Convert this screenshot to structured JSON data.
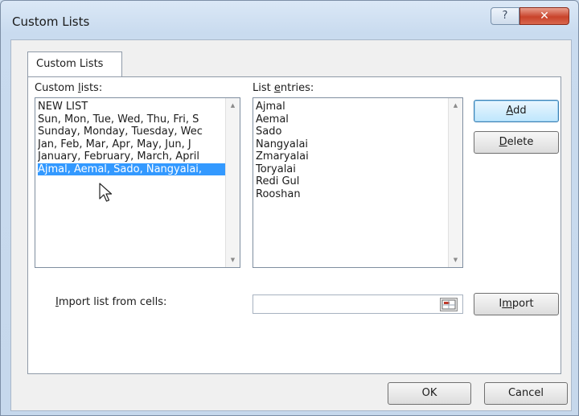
{
  "dialog": {
    "title": "Custom Lists",
    "help_glyph": "?",
    "close_glyph": "✕"
  },
  "tabs": [
    {
      "label": "Custom Lists"
    }
  ],
  "custom_lists": {
    "label_pre": "Custom ",
    "label_ul": "l",
    "label_post": "ists:",
    "items": [
      "NEW LIST",
      "Sun, Mon, Tue, Wed, Thu, Fri, S",
      "Sunday, Monday, Tuesday, Wec",
      "Jan, Feb, Mar, Apr, May, Jun, J",
      "January, February, March, April",
      "Ajmal, Aemal, Sado, Nangyalai,"
    ],
    "selected": "Ajmal, Aemal, Sado, Nangyalai,"
  },
  "list_entries": {
    "label_pre": "List ",
    "label_ul": "e",
    "label_post": "ntries:",
    "items": [
      "Ajmal",
      "Aemal",
      "Sado",
      "Nangyalai",
      "Zmaryalai",
      "Toryalai",
      "Redi Gul",
      "Rooshan"
    ]
  },
  "buttons": {
    "add_ul": "A",
    "add_post": "dd",
    "delete_ul": "D",
    "delete_post": "elete",
    "import_pre": "I",
    "import_ul": "m",
    "import_post": "port",
    "ok": "OK",
    "cancel": "Cancel"
  },
  "import": {
    "label_ul": "I",
    "label_post": "mport list from cells:",
    "value": ""
  }
}
